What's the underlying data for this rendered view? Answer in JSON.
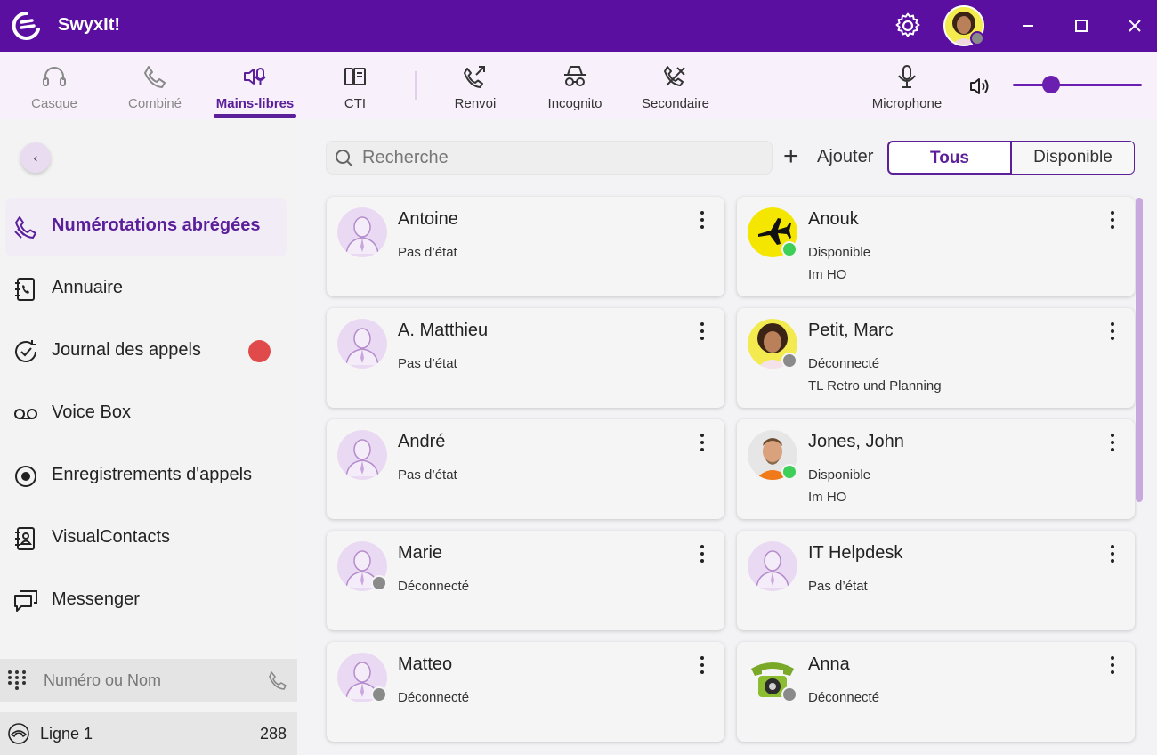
{
  "app": {
    "title": "SwyxIt!"
  },
  "toolbar": {
    "items": [
      {
        "label": "Casque",
        "icon": "headset-icon",
        "state": "disabled"
      },
      {
        "label": "Combiné",
        "icon": "handset-icon",
        "state": "disabled"
      },
      {
        "label": "Mains-libres",
        "icon": "speakerphone-icon",
        "state": "active"
      },
      {
        "label": "CTI",
        "icon": "cti-icon",
        "state": "normal"
      },
      {
        "label": "Renvoi",
        "icon": "forward-call-icon",
        "state": "normal"
      },
      {
        "label": "Incognito",
        "icon": "incognito-icon",
        "state": "normal"
      },
      {
        "label": "Secondaire",
        "icon": "secondary-call-icon",
        "state": "normal"
      },
      {
        "label": "Microphone",
        "icon": "microphone-icon",
        "state": "normal"
      }
    ],
    "volume_level": 0.25
  },
  "sidebar": {
    "items": [
      {
        "label": "Numérotations abrégées",
        "icon": "speed-dial-icon",
        "active": true
      },
      {
        "label": "Annuaire",
        "icon": "phonebook-icon",
        "active": false
      },
      {
        "label": "Journal des appels",
        "icon": "call-log-icon",
        "active": false,
        "badge": true
      },
      {
        "label": "Voice Box",
        "icon": "voicemail-icon",
        "active": false
      },
      {
        "label": "Enregistrements d'appels",
        "icon": "record-icon",
        "active": false
      },
      {
        "label": "VisualContacts",
        "icon": "contacts-icon",
        "active": false
      },
      {
        "label": "Messenger",
        "icon": "messenger-icon",
        "active": false
      }
    ],
    "dial_placeholder": "Numéro ou Nom",
    "line": {
      "name": "Ligne 1",
      "number": "288"
    }
  },
  "content": {
    "search_placeholder": "Recherche",
    "add_label": "Ajouter",
    "filter": {
      "all": "Tous",
      "available": "Disponible"
    }
  },
  "contacts": [
    {
      "name": "Antoine",
      "status": "Pas d’état",
      "note": "",
      "avatar": "default"
    },
    {
      "name": "Anouk",
      "status": "Disponible",
      "note": "Im HO",
      "avatar": "airplane",
      "presence": "#3ecf58"
    },
    {
      "name": "A. Matthieu",
      "status": "Pas d’état",
      "note": "",
      "avatar": "default"
    },
    {
      "name": "Petit, Marc",
      "status": "Déconnecté",
      "note": "TL Retro und Planning",
      "avatar": "photo-woman",
      "presence": "#8a8a8a"
    },
    {
      "name": "André",
      "status": "Pas d’état",
      "note": "",
      "avatar": "default"
    },
    {
      "name": "Jones, John",
      "status": "Disponible",
      "note": "Im HO",
      "avatar": "photo-man",
      "presence": "#3ecf58"
    },
    {
      "name": "Marie",
      "status": "Déconnecté",
      "note": "",
      "avatar": "default",
      "presence": "#8a8a8a"
    },
    {
      "name": "IT Helpdesk",
      "status": "Pas d’état",
      "note": "",
      "avatar": "default"
    },
    {
      "name": "Matteo",
      "status": "Déconnecté",
      "note": "",
      "avatar": "default",
      "presence": "#8a8a8a"
    },
    {
      "name": "Anna",
      "status": "Déconnecté",
      "note": "",
      "avatar": "phone",
      "presence": "#8a8a8a"
    }
  ],
  "colors": {
    "brand": "#5b0fa0",
    "accent": "#5b1f9a",
    "available": "#3ecf58",
    "offline": "#8a8a8a",
    "badge": "#e04a4a"
  }
}
